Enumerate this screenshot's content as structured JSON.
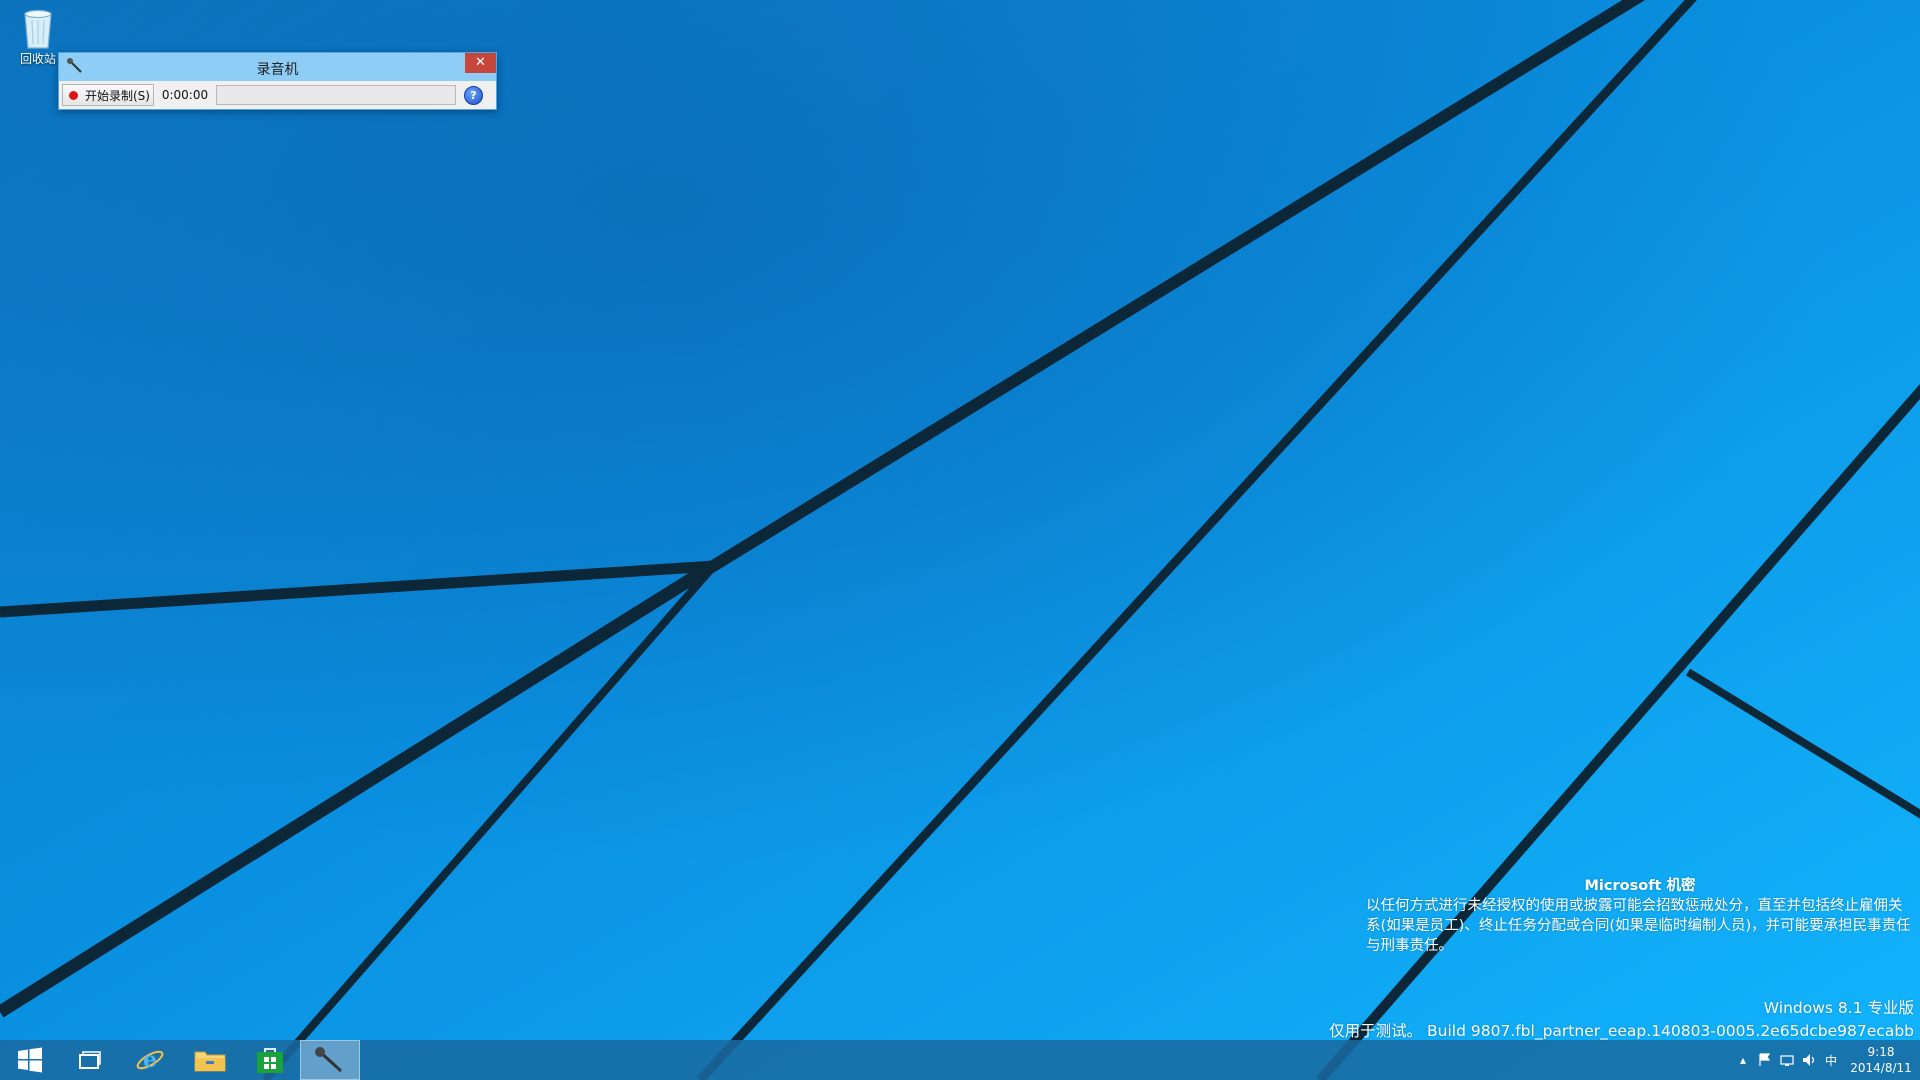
{
  "desktop": {
    "recycle_bin_label": "回收站"
  },
  "recorder": {
    "title": "录音机",
    "close_symbol": "✕",
    "start_label": "开始录制(S)",
    "elapsed": "0:00:00",
    "progress": 0,
    "help_symbol": "?"
  },
  "watermark": {
    "title": "Microsoft 机密",
    "body": "以任何方式进行未经授权的使用或披露可能会招致惩戒处分，直至并包括终止雇佣关系(如果是员工)、终止任务分配或合同(如果是临时编制人员)，并可能要承担民事责任与刑事责任。",
    "edition": "Windows 8.1 专业版",
    "build": "仅用于测试。 Build 9807.fbl_partner_eeap.140803-0005.2e65dcbe987ecabb"
  },
  "taskbar": {
    "items": [
      {
        "name": "start",
        "icon": "windows-logo-icon"
      },
      {
        "name": "task-view",
        "icon": "task-view-icon"
      },
      {
        "name": "internet-explorer",
        "icon": "ie-icon"
      },
      {
        "name": "file-explorer",
        "icon": "folder-icon"
      },
      {
        "name": "store",
        "icon": "store-icon"
      },
      {
        "name": "sound-recorder",
        "icon": "microphone-icon",
        "active": true
      }
    ],
    "tray": {
      "ime": "中",
      "time": "9:18",
      "date": "2014/8/11"
    }
  }
}
